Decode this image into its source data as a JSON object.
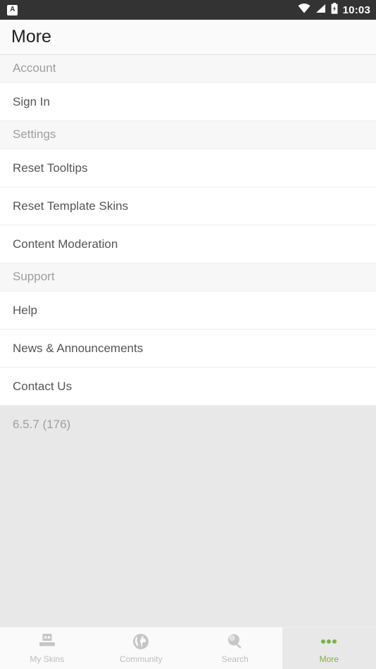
{
  "statusbar": {
    "app_icon_name": "app-badge-icon",
    "app_icon_letter": "A",
    "wifi_icon": "wifi-icon",
    "signal_icon": "cellular-signal-icon",
    "battery_icon": "battery-icon",
    "time": "10:03"
  },
  "header": {
    "title": "More"
  },
  "list": [
    {
      "kind": "header",
      "label": "Account",
      "name": "section-header-account"
    },
    {
      "kind": "row",
      "label": "Sign In",
      "name": "list-item-sign-in"
    },
    {
      "kind": "header",
      "label": "Settings",
      "name": "section-header-settings"
    },
    {
      "kind": "row",
      "label": "Reset Tooltips",
      "name": "list-item-reset-tooltips"
    },
    {
      "kind": "row",
      "label": "Reset Template Skins",
      "name": "list-item-reset-template-skins"
    },
    {
      "kind": "row",
      "label": "Content Moderation",
      "name": "list-item-content-moderation"
    },
    {
      "kind": "header",
      "label": "Support",
      "name": "section-header-support"
    },
    {
      "kind": "row",
      "label": "Help",
      "name": "list-item-help"
    },
    {
      "kind": "row",
      "label": "News & Announcements",
      "name": "list-item-news-announcements"
    },
    {
      "kind": "row",
      "label": "Contact Us",
      "name": "list-item-contact-us"
    }
  ],
  "version": {
    "text": "6.5.7 (176)"
  },
  "navbar": {
    "items": [
      {
        "label": "My Skins",
        "icon": "skin-character-icon",
        "name": "nav-item-my-skins",
        "active": false
      },
      {
        "label": "Community",
        "icon": "globe-icon",
        "name": "nav-item-community",
        "active": false
      },
      {
        "label": "Search",
        "icon": "magnifier-icon",
        "name": "nav-item-search",
        "active": false
      },
      {
        "label": "More",
        "icon": "three-dots-icon",
        "name": "nav-item-more",
        "active": true
      }
    ]
  },
  "colors": {
    "statusbar_bg": "#333333",
    "accent_green": "#7cb342",
    "section_header_bg": "#f7f7f7",
    "section_header_text": "#9e9e9e",
    "row_text": "#555555",
    "version_bg": "#e8e8e8",
    "nav_inactive": "#bdbdbd"
  }
}
